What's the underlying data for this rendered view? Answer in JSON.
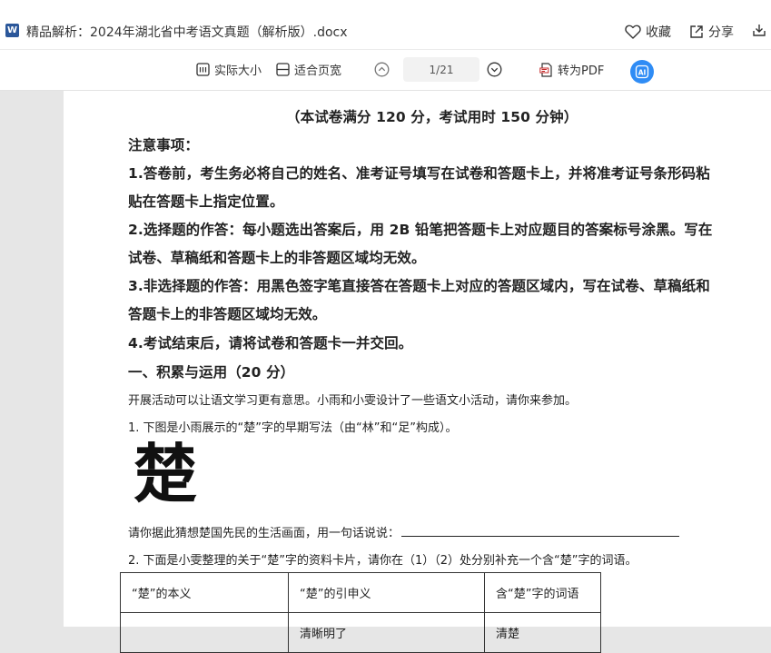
{
  "titlebar": {
    "app_icon_letter": "W",
    "doc_title": "精品解析：2024年湖北省中考语文真题（解析版）.docx",
    "favorite_label": "收藏",
    "share_label": "分享"
  },
  "toolbar": {
    "actual_size_label": "实际大小",
    "fit_page_label": "适合页宽",
    "page_indicator": "1/21",
    "to_pdf_label": "转为PDF",
    "ai_label": "AI"
  },
  "document": {
    "exam_info": "（本试卷满分 120 分，考试用时 150 分钟）",
    "notice_heading": "注意事项：",
    "notice1_line1": "1.答卷前，考生务必将自己的姓名、准考证号填写在试卷和答题卡上，并将准考证号条形码粘",
    "notice1_line2": "贴在答题卡上指定位置。",
    "notice2_line1": "2.选择题的作答：每小题选出答案后，用 2B 铅笔把答题卡上对应题目的答案标号涂黑。写在",
    "notice2_line2": "试卷、草稿纸和答题卡上的非答题区域均无效。",
    "notice3_line1": "3.非选择题的作答：用黑色签字笔直接答在答题卡上对应的答题区域内，写在试卷、草稿纸和",
    "notice3_line2": "答题卡上的非答题区域均无效。",
    "notice4": "4.考试结束后，请将试卷和答题卡一并交回。",
    "section1_heading": "一、积累与运用（20 分）",
    "intro": "开展活动可以让语文学习更有意思。小雨和小雯设计了一些语文小活动，请你来参加。",
    "q1": "1. 下图是小雨展示的“楚”字的早期写法（由“林”和“足”构成）。",
    "chu_glyph": "楚",
    "q1_prompt": "请你据此猜想楚国先民的生活画面，用一句话说说：",
    "q2": "2. 下面是小雯整理的关于“楚”字的资料卡片，请你在（1）（2）处分别补充一个含“楚”字的词语。",
    "table_headers": [
      "“楚”的本义",
      "“楚”的引申义",
      "含“楚”字的词语"
    ],
    "table_row2": [
      "",
      "清晰明了",
      "清楚"
    ]
  }
}
